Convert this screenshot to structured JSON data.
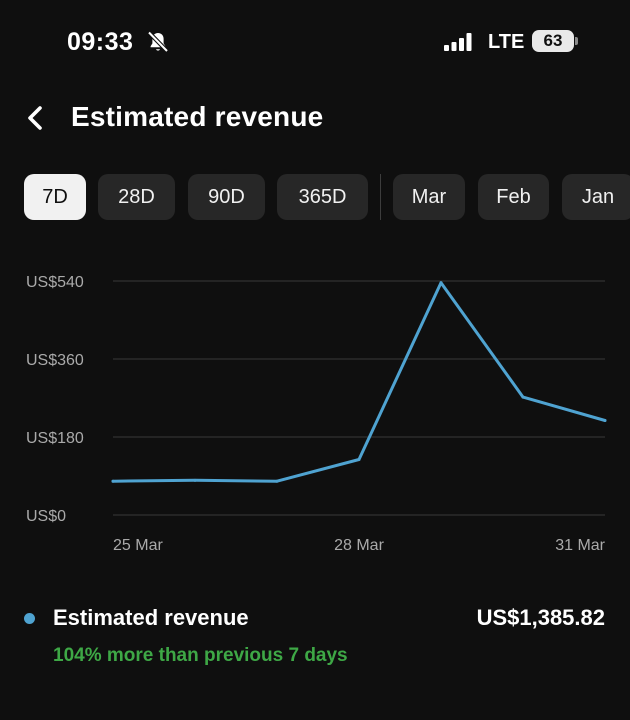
{
  "status_bar": {
    "time": "09:33",
    "network": "LTE",
    "battery": "63",
    "icons": [
      "bell-slash-icon",
      "signal-bars-icon"
    ]
  },
  "header": {
    "title": "Estimated revenue",
    "back_icon": "chevron-left-icon"
  },
  "filters": {
    "selected": "7D",
    "chips": [
      "7D",
      "28D",
      "90D",
      "365D",
      "Mar",
      "Feb",
      "Jan"
    ]
  },
  "chart_data": {
    "type": "line",
    "x": [
      "25 Mar",
      "26 Mar",
      "27 Mar",
      "28 Mar",
      "29 Mar",
      "30 Mar",
      "31 Mar"
    ],
    "x_tick_labels": [
      "25 Mar",
      "28 Mar",
      "31 Mar"
    ],
    "series": [
      {
        "values": [
          78,
          80,
          78,
          128,
          536,
          272,
          218
        ]
      }
    ],
    "y_ticks": [
      "US$0",
      "US$180",
      "US$360",
      "US$540"
    ],
    "ylim": [
      0,
      540
    ],
    "grid": true
  },
  "summary": {
    "metric_label": "Estimated revenue",
    "metric_value": "US$1,385.82",
    "comparison": "104% more than previous 7 days"
  },
  "colors": {
    "background": "#0f0f0f",
    "series_line": "#4fa3d1",
    "positive_text": "#3ea846",
    "chip_bg": "#272727",
    "chip_selected_bg": "#f1f1f1"
  }
}
